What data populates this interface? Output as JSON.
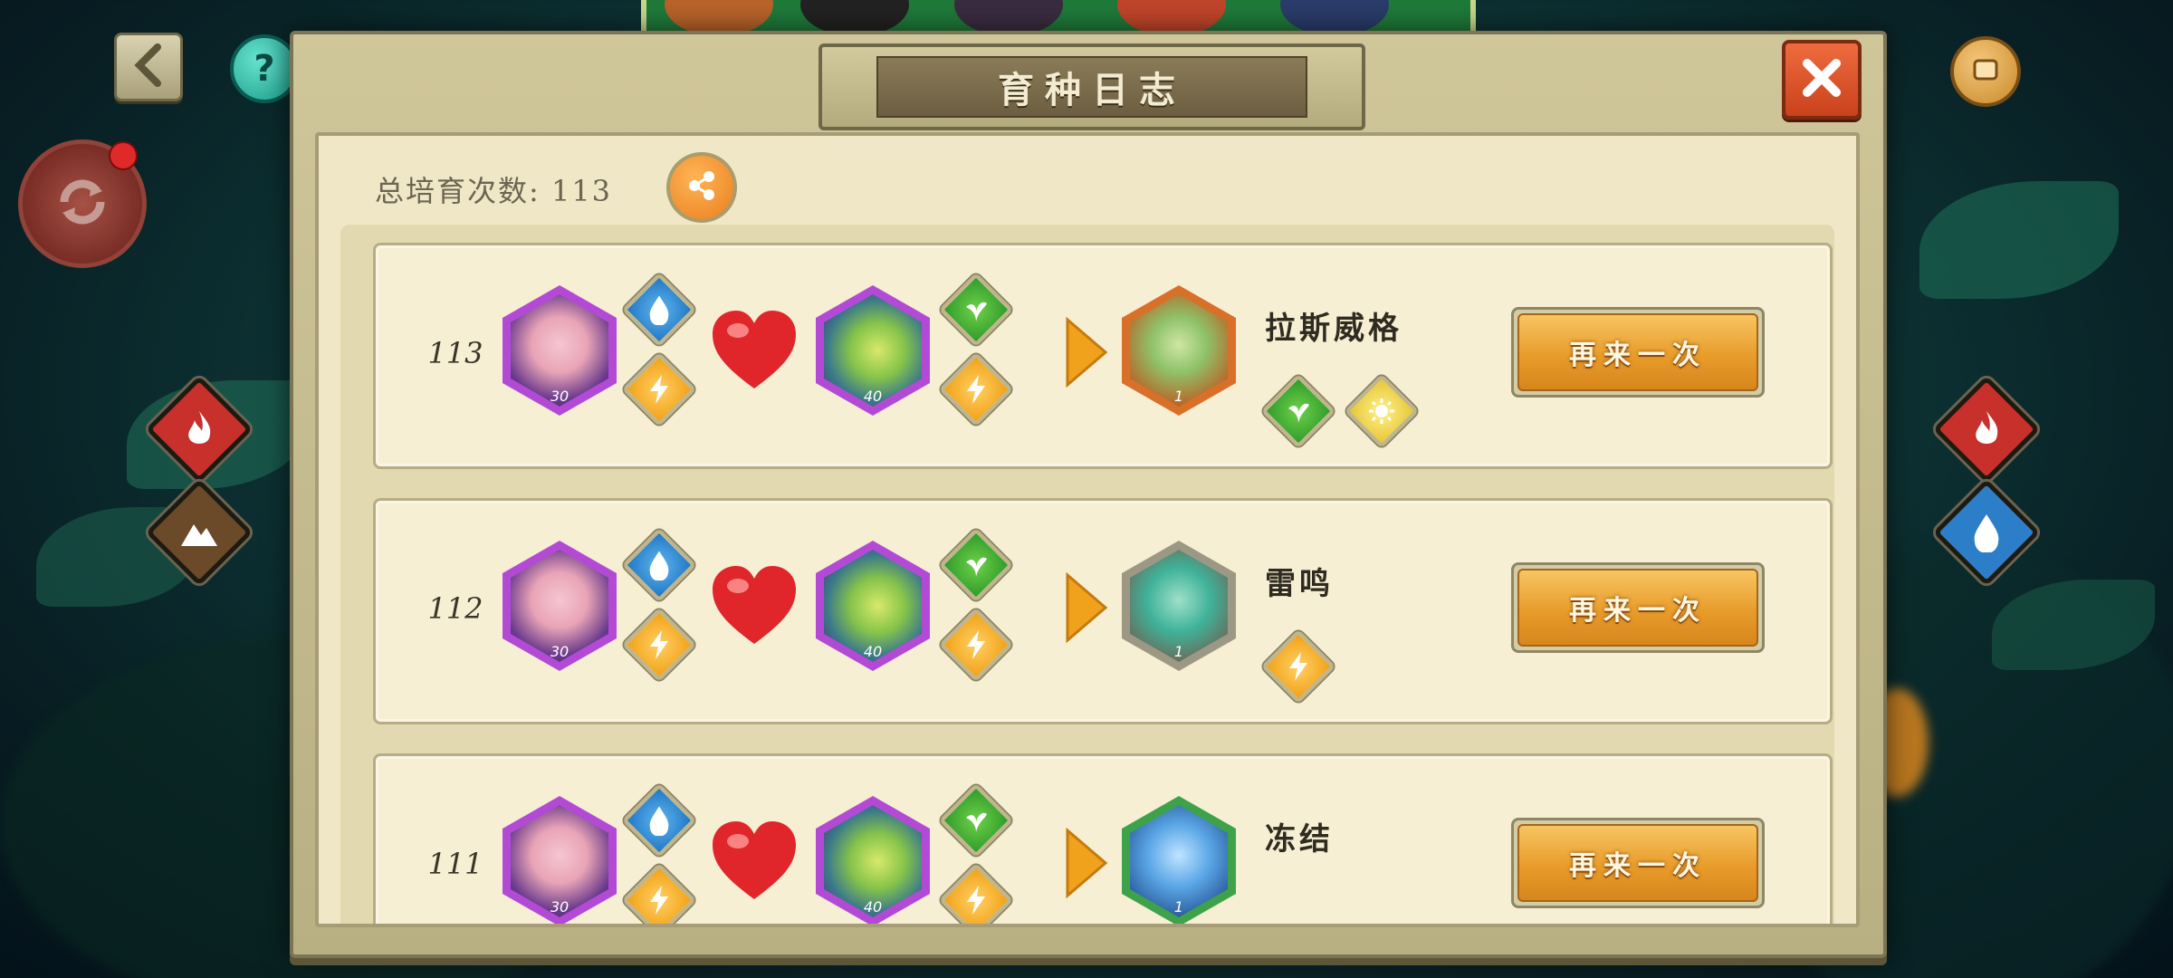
{
  "panel": {
    "title": "育种日志",
    "total_label": "总培育次数: 113"
  },
  "records": [
    {
      "index": "113",
      "parent1": {
        "level": "30",
        "color": "#b34ad6",
        "elements": [
          "water",
          "thunder"
        ]
      },
      "parent2": {
        "level": "40",
        "color": "#b34ad6",
        "elements": [
          "plant",
          "thunder"
        ]
      },
      "child": {
        "name": "拉斯威格",
        "level": "1",
        "frame_color": "#d9702a",
        "elements": [
          "plant",
          "light"
        ]
      },
      "again_label": "再来一次"
    },
    {
      "index": "112",
      "parent1": {
        "level": "30",
        "color": "#b34ad6",
        "elements": [
          "water",
          "thunder"
        ]
      },
      "parent2": {
        "level": "40",
        "color": "#b34ad6",
        "elements": [
          "plant",
          "thunder"
        ]
      },
      "child": {
        "name": "雷鸣",
        "level": "1",
        "frame_color": "#9c9884",
        "elements": [
          "thunder"
        ]
      },
      "again_label": "再来一次"
    },
    {
      "index": "111",
      "parent1": {
        "level": "30",
        "color": "#b34ad6",
        "elements": [
          "water",
          "thunder"
        ]
      },
      "parent2": {
        "level": "40",
        "color": "#b34ad6",
        "elements": [
          "plant",
          "thunder"
        ]
      },
      "child": {
        "name": "冻结",
        "level": "1",
        "frame_color": "#3ea24a",
        "elements": []
      },
      "again_label": "再来一次"
    }
  ],
  "left_elements": [
    "fire-icon",
    "mountain-icon"
  ],
  "right_elements": [
    "fire-icon",
    "water-icon"
  ],
  "colors": {
    "fire": "#c7302b",
    "earth": "#6b4a2a",
    "water": "#2d7ec9",
    "thunder": "#f2a116",
    "plant": "#2f9b2a",
    "light": "#e6c635",
    "orange_button": "#e89c2a",
    "close_button": "#d4502a"
  }
}
